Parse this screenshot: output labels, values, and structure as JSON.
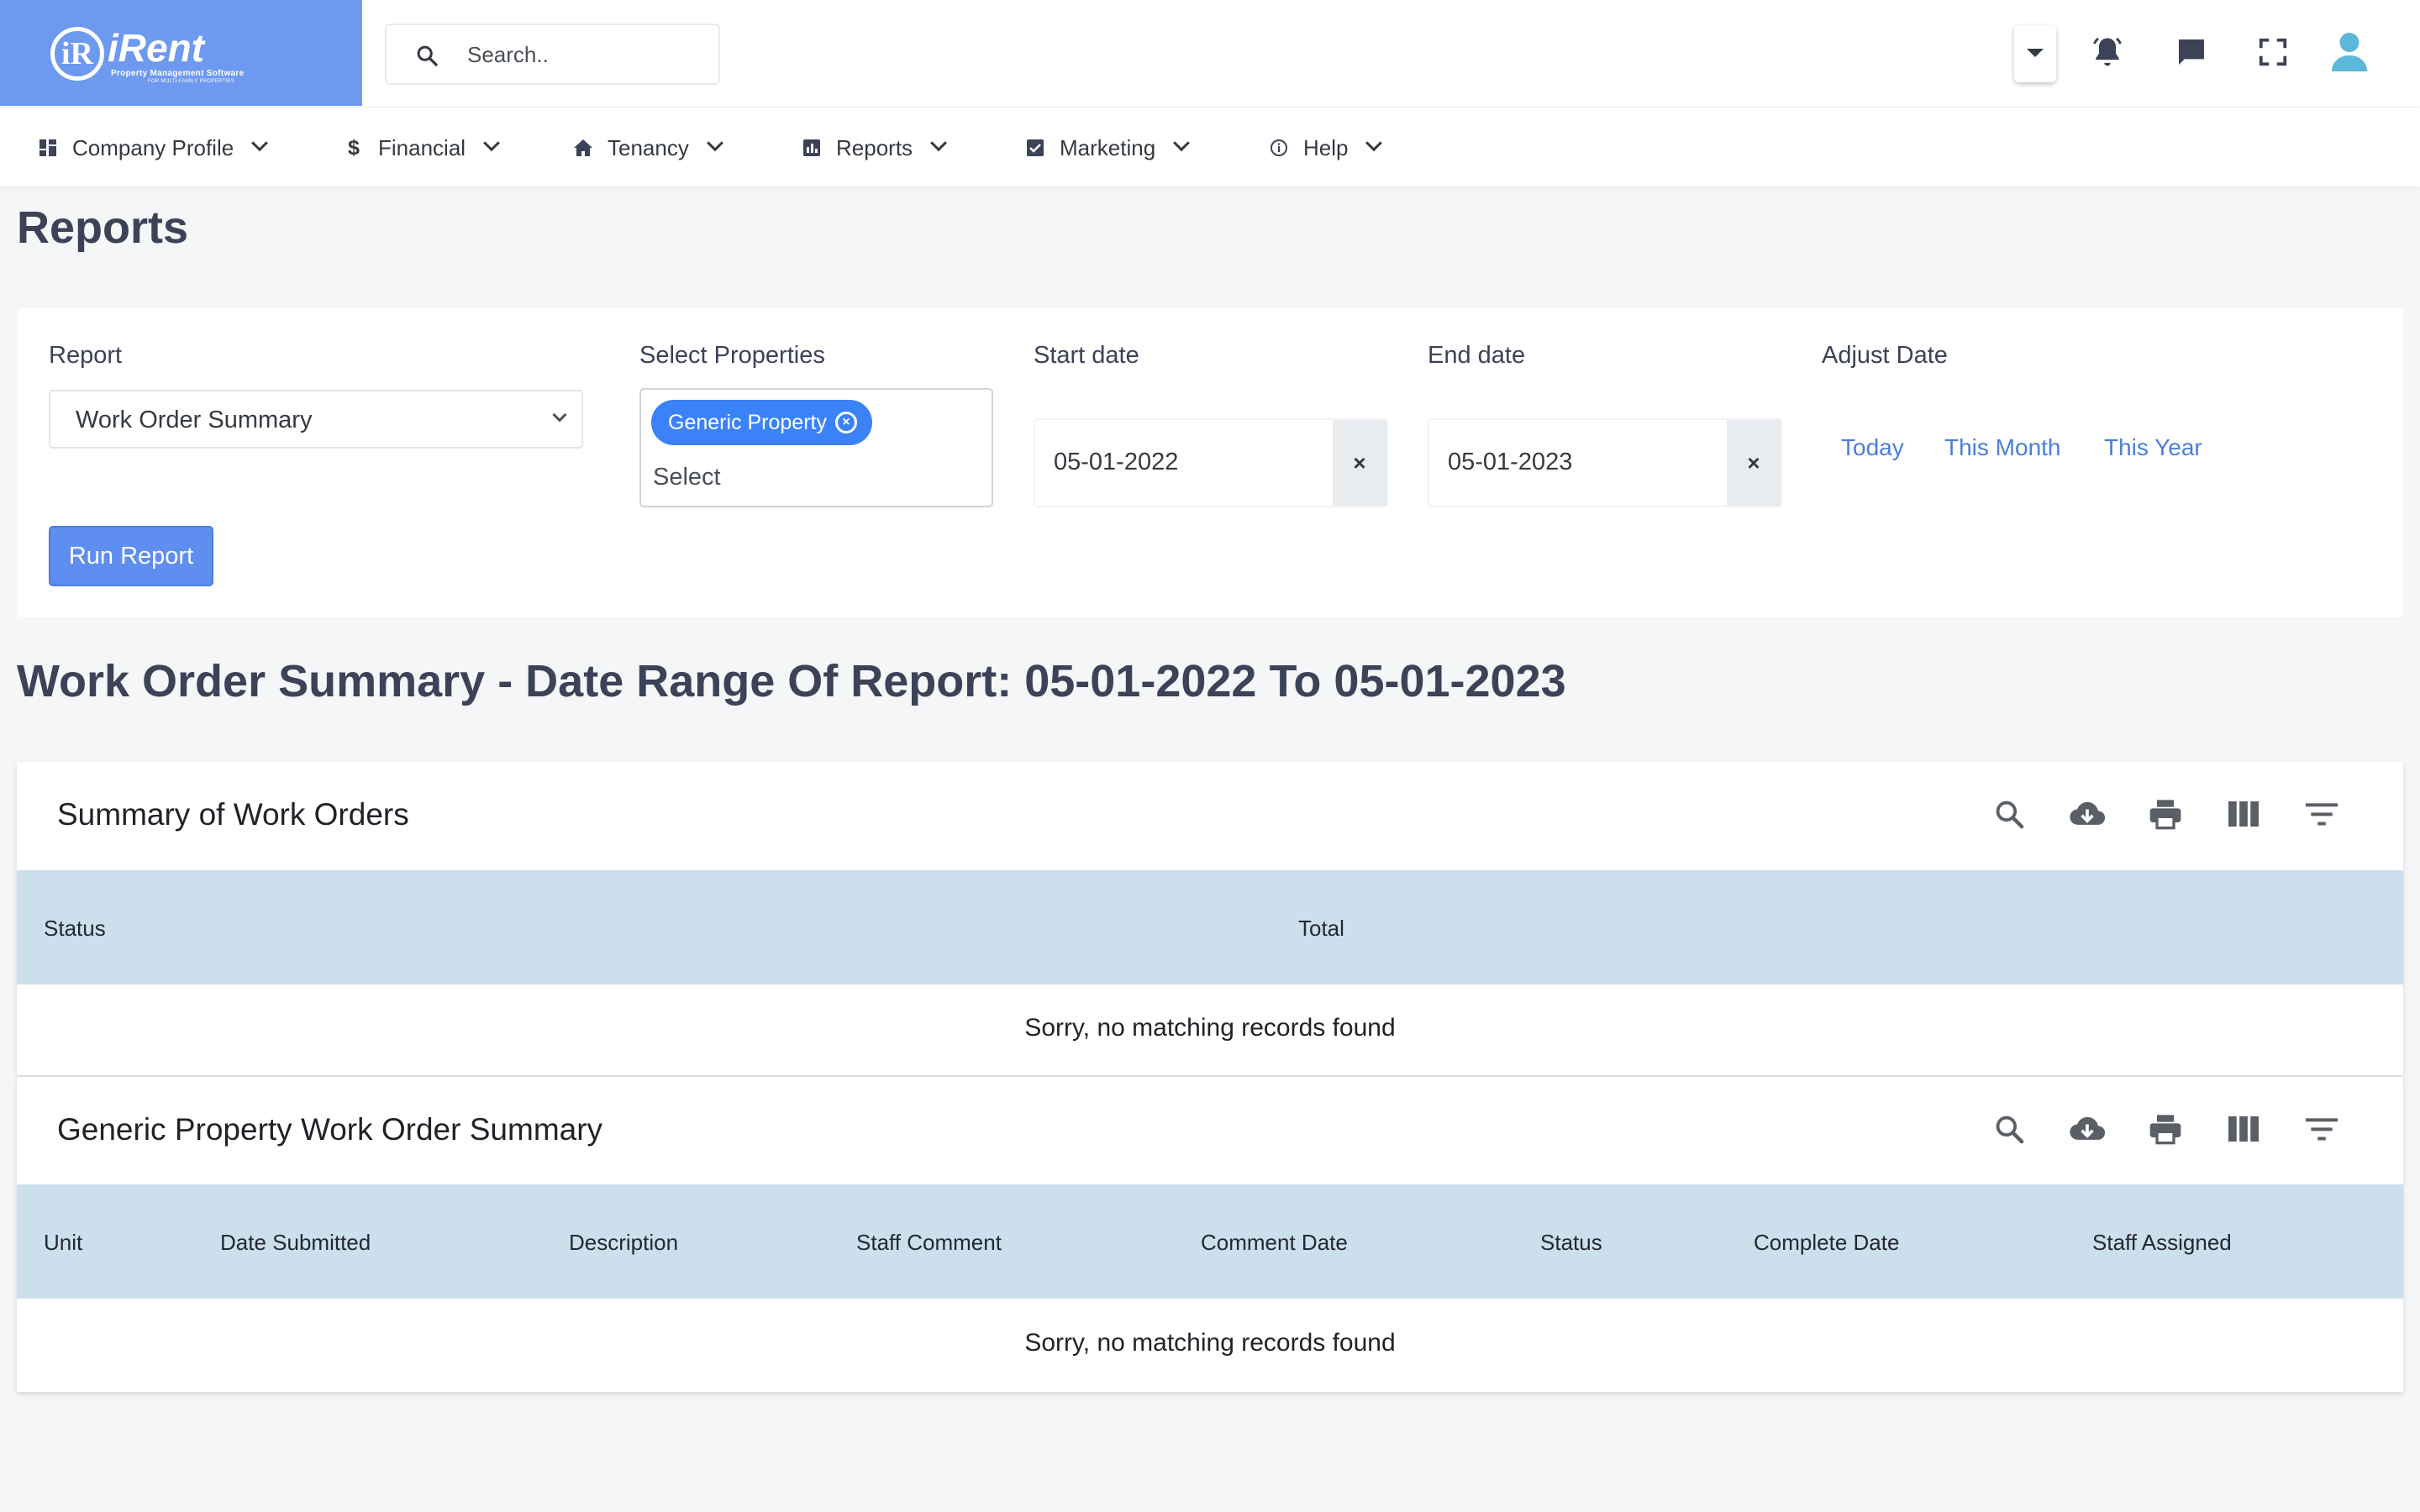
{
  "brand": {
    "logo_mark": "iR",
    "name": "iRent",
    "tagline": "Property Management Software",
    "tagline_sub": "FOR MULTI-FAMILY PROPERTIES",
    "color": "#6d99ef"
  },
  "search": {
    "placeholder": "Search.."
  },
  "header_icons": [
    "chevron-down-icon",
    "bell-icon",
    "chat-icon",
    "fullscreen-icon",
    "user-icon"
  ],
  "nav": {
    "items": [
      {
        "label": "Company Profile",
        "icon": "dashboard-icon"
      },
      {
        "label": "Financial",
        "icon": "dollar-icon"
      },
      {
        "label": "Tenancy",
        "icon": "home-icon"
      },
      {
        "label": "Reports",
        "icon": "chart-icon"
      },
      {
        "label": "Marketing",
        "icon": "checkbox-icon"
      },
      {
        "label": "Help",
        "icon": "info-icon"
      }
    ]
  },
  "page": {
    "title": "Reports"
  },
  "filters": {
    "report_label": "Report",
    "report_value": "Work Order Summary",
    "properties_label": "Select Properties",
    "selected_property": "Generic Property",
    "properties_placeholder": "Select",
    "start_label": "Start date",
    "start_value": "05-01-2022",
    "end_label": "End date",
    "end_value": "05-01-2023",
    "clear_symbol": "×",
    "adjust_label": "Adjust Date",
    "adjust_options": [
      "Today",
      "This Month",
      "This Year"
    ],
    "run_button": "Run Report"
  },
  "report_heading": "Work Order Summary - Date Range Of Report: 05-01-2022 To 05-01-2023",
  "tables": [
    {
      "title": "Summary of Work Orders",
      "columns": [
        "Status",
        "Total"
      ],
      "empty_text": "Sorry, no matching records found"
    },
    {
      "title": "Generic Property Work Order Summary",
      "columns": [
        "Unit",
        "Date Submitted",
        "Description",
        "Staff Comment",
        "Comment Date",
        "Status",
        "Complete Date",
        "Staff Assigned"
      ],
      "empty_text": "Sorry, no matching records found"
    }
  ],
  "table_tools": [
    "search-icon",
    "download-icon",
    "print-icon",
    "columns-icon",
    "filter-icon"
  ],
  "colors": {
    "accent": "#5e8ef0",
    "chip": "#3b82f6",
    "link": "#4a7fd8",
    "table_header": "#cbe0ec",
    "user_icon": "#5bb8d8"
  }
}
